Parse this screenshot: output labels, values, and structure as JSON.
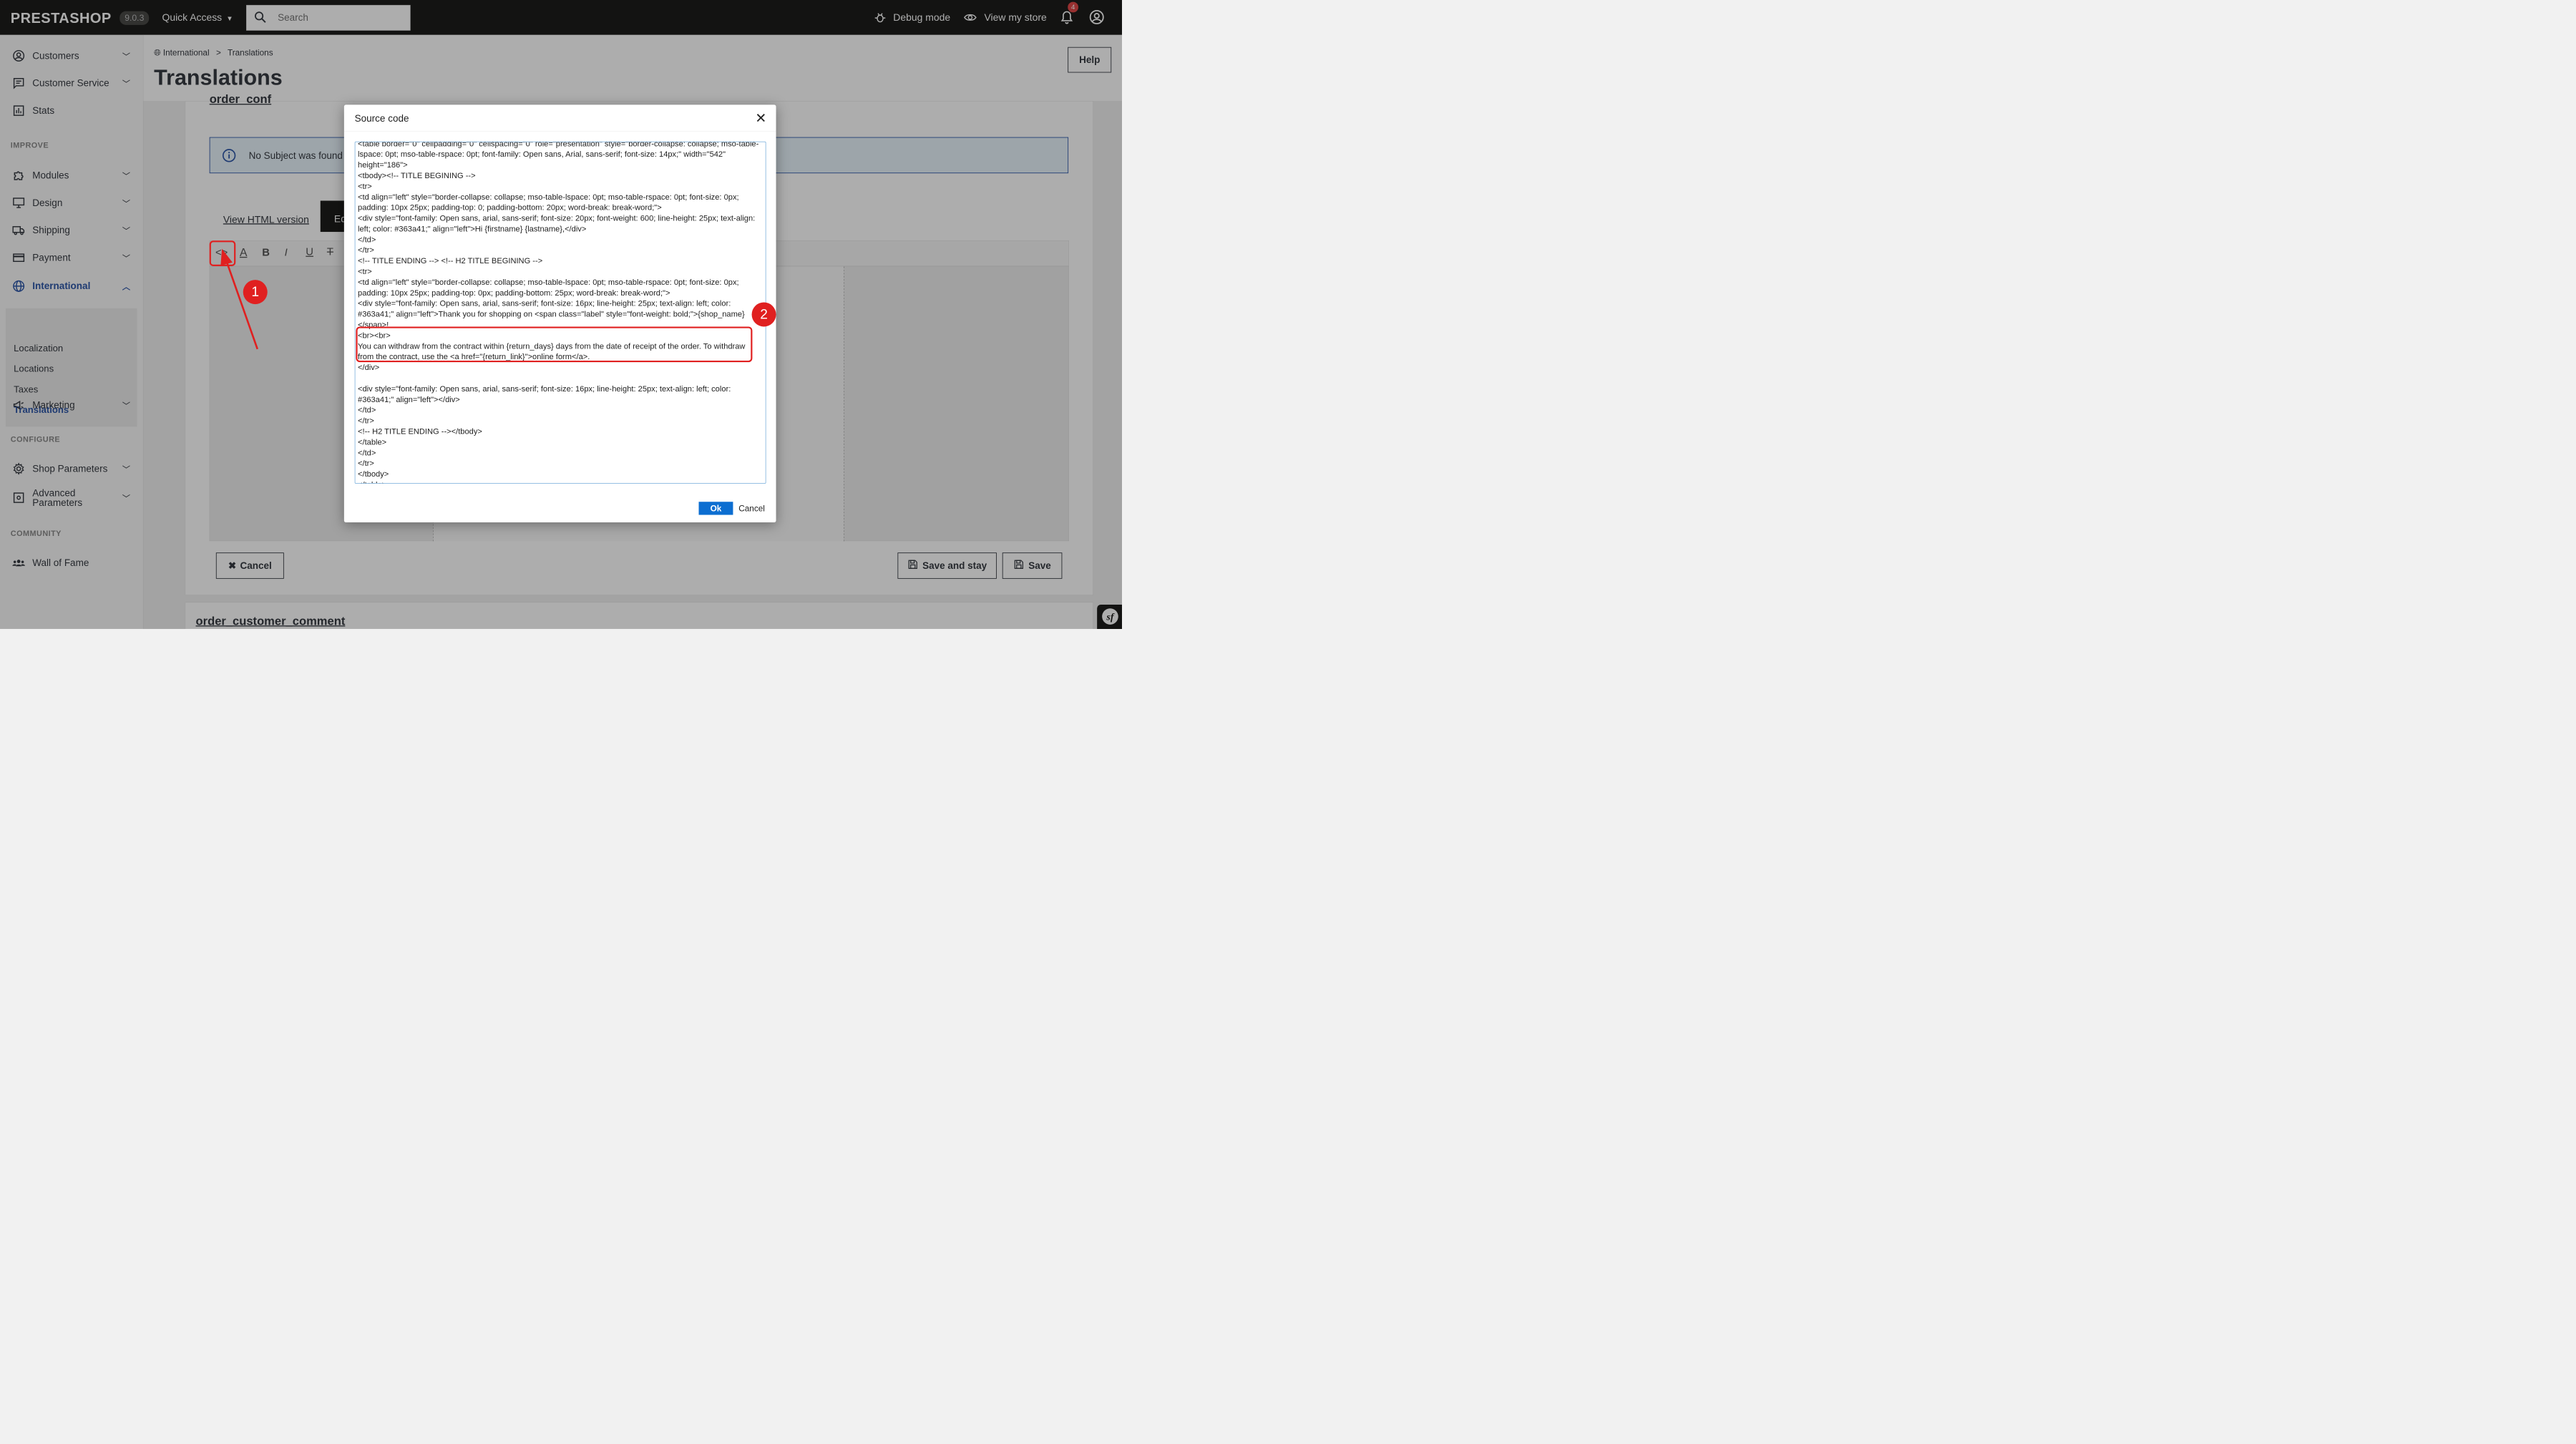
{
  "topbar": {
    "logo": "PRESTASHOP",
    "version": "9.0.3",
    "quick_access": "Quick Access",
    "search_placeholder": "Search",
    "debug_mode": "Debug mode",
    "view_store": "View my store",
    "notification_count": "4"
  },
  "sidebar": {
    "items": {
      "customers": "Customers",
      "customer_service": "Customer Service",
      "stats": "Stats",
      "modules": "Modules",
      "design": "Design",
      "shipping": "Shipping",
      "payment": "Payment",
      "international": "International",
      "marketing": "Marketing",
      "shop_parameters": "Shop Parameters",
      "advanced_parameters": "Advanced Parameters",
      "wall_of_fame": "Wall of Fame"
    },
    "sections": {
      "improve": "IMPROVE",
      "configure": "CONFIGURE",
      "community": "COMMUNITY"
    },
    "international_sub": {
      "localization": "Localization",
      "locations": "Locations",
      "taxes": "Taxes",
      "translations": "Translations"
    }
  },
  "header": {
    "breadcrumb_parent": "International",
    "breadcrumb_sep": ">",
    "breadcrumb_current": "Translations",
    "title": "Translations",
    "help": "Help"
  },
  "content": {
    "section_title": "order_conf",
    "info_text": "No Subject was found",
    "tab_html": "View HTML version",
    "tab_edit": "Ed",
    "cancel": "Cancel",
    "save_stay": "Save and stay",
    "save": "Save",
    "next_section": "order_customer_comment"
  },
  "modal": {
    "title": "Source code",
    "ok": "Ok",
    "cancel": "Cancel",
    "code": "<table border=\"0\" cellpadding=\"0\" cellspacing=\"0\" role=\"presentation\" style=\"border-collapse: collapse; mso-table-lspace: 0pt; mso-table-rspace: 0pt; font-family: Open sans, Arial, sans-serif; font-size: 14px;\" width=\"542\" height=\"186\">\n<tbody><!-- TITLE BEGINING -->\n<tr>\n<td align=\"left\" style=\"border-collapse: collapse; mso-table-lspace: 0pt; mso-table-rspace: 0pt; font-size: 0px; padding: 10px 25px; padding-top: 0; padding-bottom: 20px; word-break: break-word;\">\n<div style=\"font-family: Open sans, arial, sans-serif; font-size: 20px; font-weight: 600; line-height: 25px; text-align: left; color: #363a41;\" align=\"left\">Hi {firstname} {lastname},</div>\n</td>\n</tr>\n<!-- TITLE ENDING --> <!-- H2 TITLE BEGINING -->\n<tr>\n<td align=\"left\" style=\"border-collapse: collapse; mso-table-lspace: 0pt; mso-table-rspace: 0pt; font-size: 0px; padding: 10px 25px; padding-top: 0px; padding-bottom: 25px; word-break: break-word;\">\n<div style=\"font-family: Open sans, arial, sans-serif; font-size: 16px; line-height: 25px; text-align: left; color: #363a41;\" align=\"left\">Thank you for shopping on <span class=\"label\" style=\"font-weight: bold;\">{shop_name}</span>!\n<br><br>\nYou can withdraw from the contract within {return_days} days from the date of receipt of the order. To withdraw from the contract, use the <a href=\"{return_link}\">online form</a>.\n</div>\n\n<div style=\"font-family: Open sans, arial, sans-serif; font-size: 16px; line-height: 25px; text-align: left; color: #363a41;\" align=\"left\"></div>\n</td>\n</tr>\n<!-- H2 TITLE ENDING --></tbody>\n</table>\n</td>\n</tr>\n</tbody>\n</table>"
  },
  "annotations": {
    "marker1": "1",
    "marker2": "2"
  },
  "colors": {
    "accent": "#25b9d7",
    "brand_nav": "#2e57a8",
    "annotation_red": "#e02020",
    "ok_button": "#0c6ed1"
  }
}
